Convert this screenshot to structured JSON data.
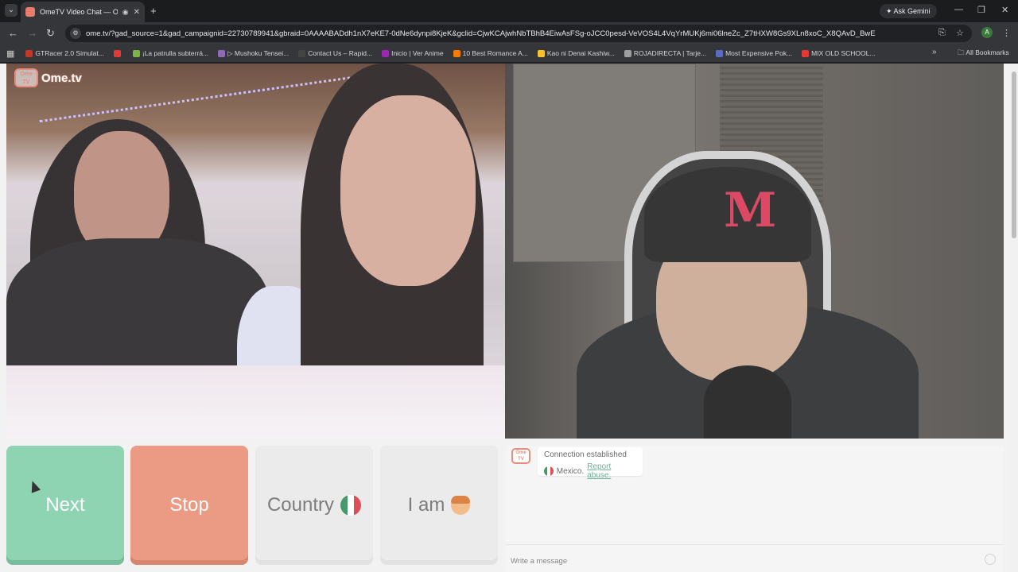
{
  "browser": {
    "tab": {
      "title": "OmeTV Video Chat — Ome"
    },
    "ask_gemini": "Ask Gemini",
    "url": "ome.tv/?gad_source=1&gad_campaignid=22730789941&gbraid=0AAAABADdh1nX7eKE7-0dNe6dynpi8KjeK&gclid=CjwKCAjwhNbTBhB4EiwAsFSg-oJCC0pesd-VeVOS4L4VqYrMUKj6mi06lneZc_Z7tHXW8Gs9XLn8xoC_X8QAvD_BwE",
    "profile_initial": "A",
    "bookmarks": [
      {
        "label": "GTRacer 2.0 Simulat...",
        "color": "#c0392b"
      },
      {
        "label": "",
        "color": "#e53935"
      },
      {
        "label": "¡La patrulla subterrá...",
        "color": "#7cb342"
      },
      {
        "label": "▷ Mushoku Tensei...",
        "color": "#8e6ab7"
      },
      {
        "label": "Contact Us – Rapid...",
        "color": "#444444"
      },
      {
        "label": "Inicio | Ver Anime",
        "color": "#9c27b0"
      },
      {
        "label": "10 Best Romance A...",
        "color": "#f57c00"
      },
      {
        "label": "Kao ni Denai Kashiw...",
        "color": "#fbc02d"
      },
      {
        "label": "ROJADIRECTA | Tarje...",
        "color": "#9e9e9e"
      },
      {
        "label": "Most Expensive Pok...",
        "color": "#5c6bc0"
      },
      {
        "label": "MIX OLD SCHOOL...",
        "color": "#e53935"
      }
    ],
    "all_bookmarks": "All Bookmarks"
  },
  "site": {
    "logo_box": "Ome TV",
    "logo_text": "Ome.tv"
  },
  "controls": {
    "next": "Next",
    "stop": "Stop",
    "country": "Country",
    "i_am": "I am"
  },
  "chat": {
    "logo": "Ome TV",
    "status": "Connection established",
    "country": "Mexico.",
    "report": "Report abuse.",
    "placeholder": "Write a message"
  },
  "colors": {
    "next": "#7fcfa9",
    "stop": "#e98e72",
    "brand": "#e97c6a",
    "link": "#5aa88a"
  }
}
